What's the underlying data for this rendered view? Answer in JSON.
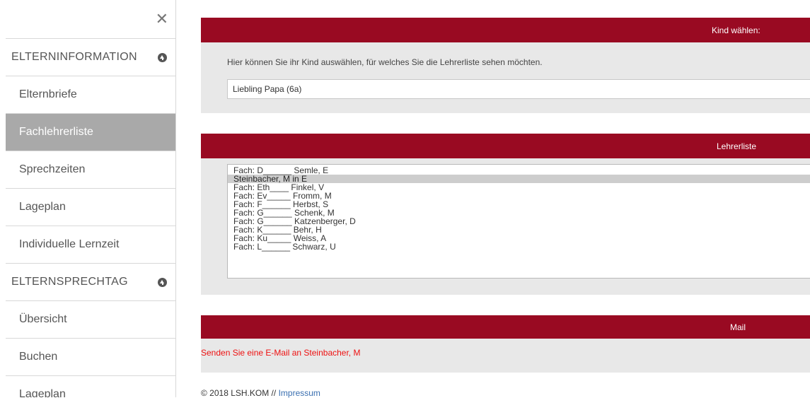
{
  "sidebar": {
    "close_glyph": "✕",
    "items": [
      {
        "type": "header",
        "label": "ELTERNINFORMATION",
        "icon": "chevron-up-circle-icon"
      },
      {
        "type": "item",
        "label": "Elternbriefe"
      },
      {
        "type": "item",
        "label": "Fachlehrerliste",
        "active": true
      },
      {
        "type": "item",
        "label": "Sprechzeiten"
      },
      {
        "type": "item",
        "label": "Lageplan"
      },
      {
        "type": "item",
        "label": "Individuelle Lernzeit"
      },
      {
        "type": "header",
        "label": "ELTERNSPRECHTAG",
        "icon": "chevron-up-circle-icon"
      },
      {
        "type": "item",
        "label": "Übersicht"
      },
      {
        "type": "item",
        "label": "Buchen"
      },
      {
        "type": "item",
        "label": "Lageplan"
      }
    ]
  },
  "kind_panel": {
    "title": "Kind wählen:",
    "description": "Hier können Sie ihr Kind auswählen, für welches Sie die Lehrerliste sehen möchten.",
    "selected_child": "Liebling Papa (6a)"
  },
  "lehrer_panel": {
    "title": "Lehrerliste",
    "options": [
      "Fach: D______ Semle, E",
      "Steinbacher, M in E",
      "Fach: Eth____ Finkel, V",
      "Fach: Ev_____ Fromm, M",
      "Fach: F______ Herbst, S",
      "Fach: G______ Schenk, M",
      "Fach: G______ Katzenberger, D",
      "Fach: K______ Behr, H",
      "Fach: Ku_____ Weiss, A",
      "Fach: L______ Schwarz, U"
    ],
    "selected_index": 1
  },
  "mail_panel": {
    "title": "Mail",
    "link_text": "Senden Sie eine E-Mail an Steinbacher, M"
  },
  "footer": {
    "copyright": "© 2018 LSH.KOM // ",
    "impressum": "Impressum"
  },
  "colors": {
    "accent": "#990a22",
    "panel_bg": "#e8e8e8",
    "active_item": "#a9a9a9",
    "mail_link": "#ee1111"
  }
}
